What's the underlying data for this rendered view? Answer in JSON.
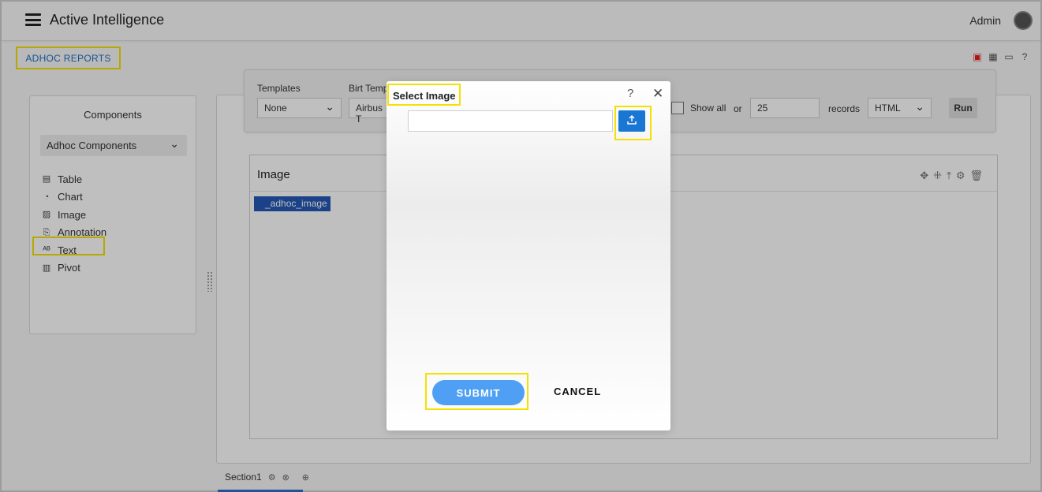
{
  "header": {
    "app_title": "Active Intelligence",
    "user_name": "Admin"
  },
  "breadcrumb": {
    "label": "ADHOC REPORTS"
  },
  "components_panel": {
    "title": "Components",
    "dropdown_value": "Adhoc Components",
    "items": [
      {
        "label": "Table",
        "icon": "table-icon"
      },
      {
        "label": "Chart",
        "icon": "chart-icon"
      },
      {
        "label": "Image",
        "icon": "image-icon"
      },
      {
        "label": "Annotation",
        "icon": "annotation-icon"
      },
      {
        "label": "Text",
        "icon": "text-icon"
      },
      {
        "label": "Pivot",
        "icon": "pivot-icon"
      }
    ]
  },
  "toolbar": {
    "templates_label": "Templates",
    "templates_value": "None",
    "birt_label": "Birt Temp",
    "birt_value": "Airbus T",
    "show_all_label": "Show all",
    "or_label": "or",
    "records_value": "25",
    "records_label": "records",
    "format_value": "HTML",
    "run_label": "Run"
  },
  "image_widget": {
    "title": "Image",
    "content_label": "_adhoc_image"
  },
  "sections": {
    "tab_label": "Section1"
  },
  "modal": {
    "title": "Select Image",
    "help_glyph": "?",
    "close_glyph": "✕",
    "file_value": "",
    "submit_label": "SUBMIT",
    "cancel_label": "CANCEL"
  },
  "colors": {
    "accent_blue": "#1976d2",
    "submit_blue": "#4fa0f5",
    "highlight_yellow": "#f5e100"
  }
}
